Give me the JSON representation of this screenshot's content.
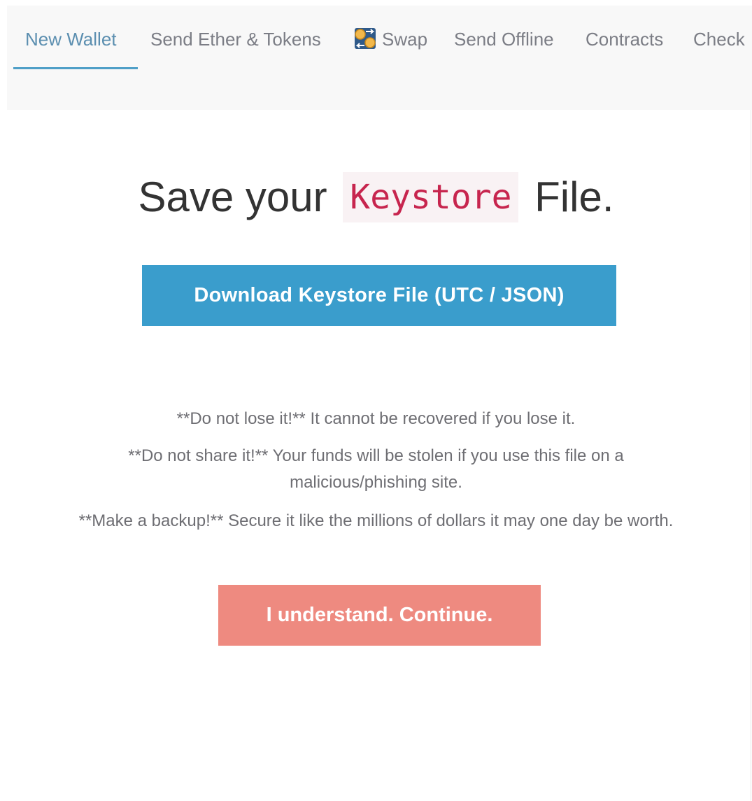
{
  "nav": {
    "items": [
      {
        "label": "New Wallet",
        "active": true
      },
      {
        "label": "Send Ether & Tokens",
        "active": false
      },
      {
        "label": "Swap",
        "active": false,
        "icon": "swap-icon"
      },
      {
        "label": "Send Offline",
        "active": false
      },
      {
        "label": "Contracts",
        "active": false
      },
      {
        "label": "Check",
        "active": false
      }
    ],
    "active_color": "#5c8fb0",
    "underline_color": "#4f9fc7"
  },
  "title": {
    "prefix": "Save your",
    "code": "Keystore",
    "suffix": "File."
  },
  "download_button": {
    "label": "Download Keystore File (UTC / JSON)",
    "color": "#3a9dcc"
  },
  "warnings": {
    "lose": "**Do not lose it!** It cannot be recovered if you lose it.",
    "share_line1": "**Do not share it!** Your funds will be stolen if you use this file on a",
    "share_line2": "malicious/phishing site.",
    "backup": "**Make a backup!** Secure it like the millions of dollars it may one day be worth."
  },
  "continue_button": {
    "label": "I understand. Continue.",
    "color": "#ee8a80"
  }
}
